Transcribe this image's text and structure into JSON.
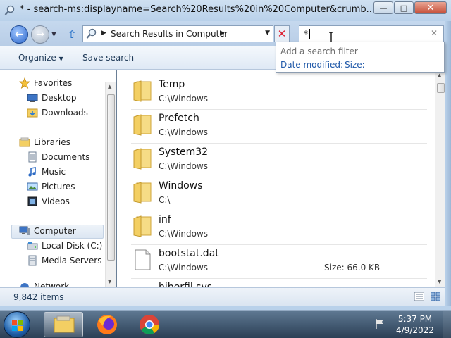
{
  "window": {
    "title": "* - search-ms:displayname=Search%20Results%20in%20Computer&crumb...",
    "controls": {
      "minimize": "—",
      "maximize": "□",
      "close": "✕"
    }
  },
  "address_bar": {
    "breadcrumb": "Search Results in Computer",
    "search_value": "*."
  },
  "toolbar": {
    "organize": "Organize",
    "save_search": "Save search"
  },
  "search_filter": {
    "title": "Add a search filter",
    "options": [
      "Date modified:",
      "Size:"
    ]
  },
  "nav_pane": {
    "favorites": {
      "label": "Favorites",
      "items": [
        "Desktop",
        "Downloads"
      ]
    },
    "libraries": {
      "label": "Libraries",
      "items": [
        "Documents",
        "Music",
        "Pictures",
        "Videos"
      ]
    },
    "computer": {
      "label": "Computer",
      "items": [
        "Local Disk (C:)",
        "Media Servers"
      ]
    },
    "network_partial": "Network"
  },
  "results": [
    {
      "name": "Temp",
      "path": "C:\\Windows",
      "type": "folder"
    },
    {
      "name": "Prefetch",
      "path": "C:\\Windows",
      "type": "folder"
    },
    {
      "name": "System32",
      "path": "C:\\Windows",
      "type": "folder"
    },
    {
      "name": "Windows",
      "path": "C:\\",
      "type": "folder"
    },
    {
      "name": "inf",
      "path": "C:\\Windows",
      "type": "folder"
    },
    {
      "name": "bootstat.dat",
      "path": "C:\\Windows",
      "type": "file",
      "size": "Size: 66.0 KB"
    },
    {
      "name": "hiberfil.sys",
      "path": "",
      "type": "file"
    }
  ],
  "status": {
    "item_count": "9,842 items"
  },
  "taskbar": {
    "time": "5:37 PM",
    "date": "4/9/2022"
  },
  "colors": {
    "title_bar": "#b9d1ea",
    "link_blue": "#1f58a8",
    "folder_yellow": "#f3cf63"
  },
  "icons": {
    "favorites": "star-icon",
    "libraries": "library-icon",
    "computer": "computer-icon"
  }
}
